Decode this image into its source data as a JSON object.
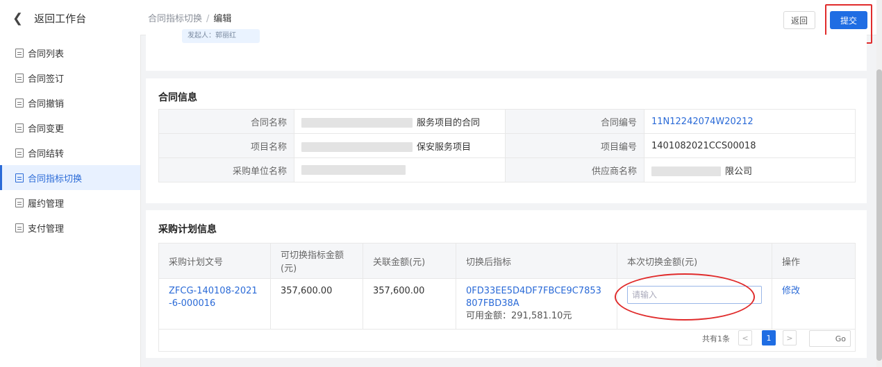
{
  "sidebar": {
    "back_label": "返回工作台",
    "items": [
      {
        "label": "合同列表",
        "active": false
      },
      {
        "label": "合同签订",
        "active": false
      },
      {
        "label": "合同撤销",
        "active": false
      },
      {
        "label": "合同变更",
        "active": false
      },
      {
        "label": "合同结转",
        "active": false
      },
      {
        "label": "合同指标切换",
        "active": true
      },
      {
        "label": "履约管理",
        "active": false
      },
      {
        "label": "支付管理",
        "active": false
      }
    ]
  },
  "header": {
    "breadcrumb_parent": "合同指标切换",
    "breadcrumb_sep": "/",
    "breadcrumb_current": "编辑",
    "back_button": "返回",
    "submit_button": "提交"
  },
  "top_card": {
    "fragment_text": "发起人：郭丽红"
  },
  "contract_info": {
    "title": "合同信息",
    "rows": [
      {
        "label1": "合同名称",
        "value1": "服务项目的合同",
        "label2": "合同编号",
        "value2": "11N12242074W20212"
      },
      {
        "label1": "项目名称",
        "value1": "保安服务项目",
        "label2": "项目编号",
        "value2": "1401082021CCS00018"
      },
      {
        "label1": "采购单位名称",
        "value1": "",
        "label2": "供应商名称",
        "value2": "限公司"
      }
    ]
  },
  "plan_info": {
    "title": "采购计划信息",
    "columns": [
      "采购计划文号",
      "可切换指标金额(元)",
      "关联金额(元)",
      "切换后指标",
      "本次切换金额(元)",
      "操作"
    ],
    "rows": [
      {
        "plan_no": "ZFCG-140108-2021-6-000016",
        "switchable_amount": "357,600.00",
        "related_amount": "357,600.00",
        "indicator_code": "0FD33EE5D4DF7FBCE9C7853807FBD38A",
        "available_amount": "可用金额：291,581.10元",
        "amount_placeholder": "请输入",
        "action": "修改"
      }
    ]
  },
  "pagination": {
    "total": "共有1条",
    "prev": "<",
    "current": "1",
    "next": ">",
    "go": "Go"
  }
}
